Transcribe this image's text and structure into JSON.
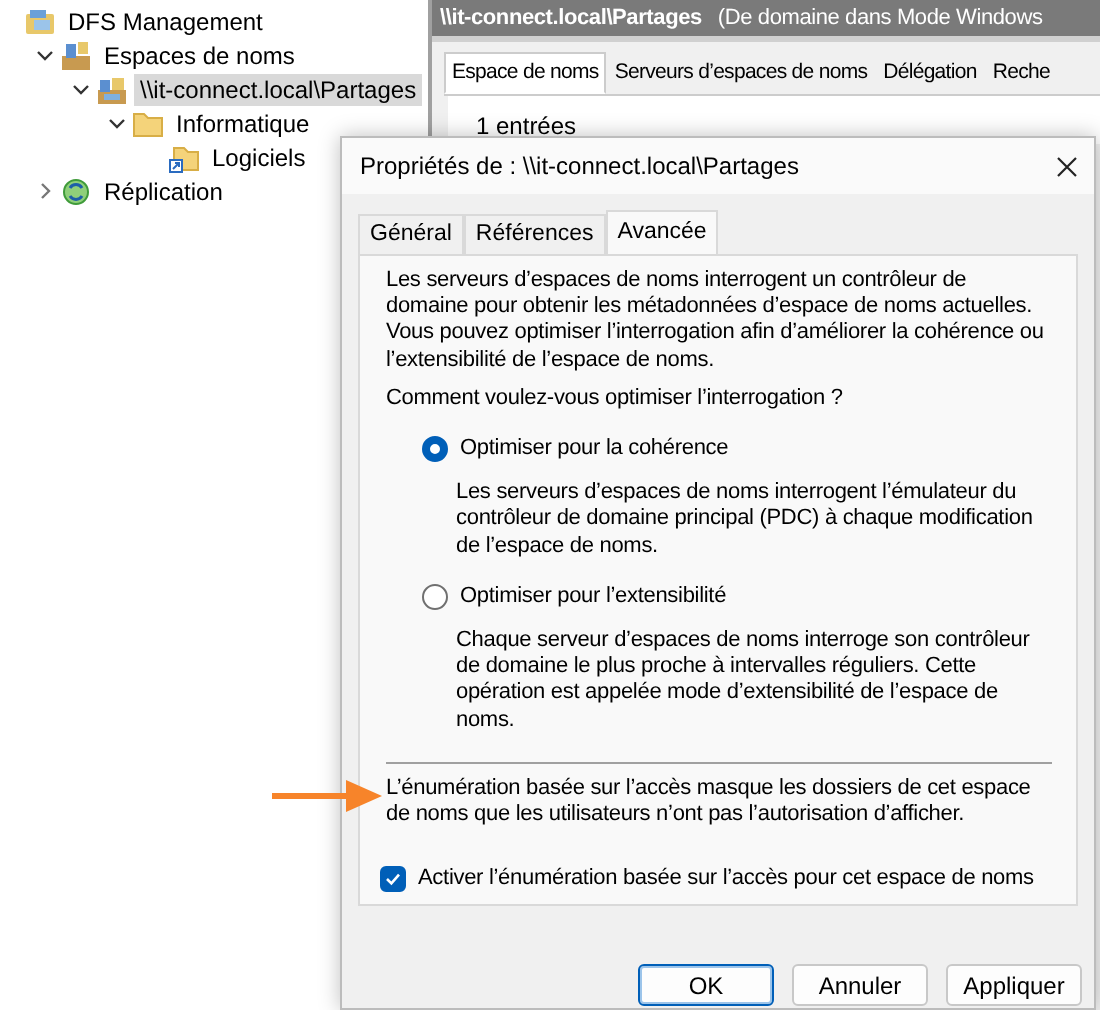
{
  "tree": [
    {
      "label": "DFS Management",
      "kind": "root",
      "selected": false,
      "children": [
        {
          "label": "Espaces de noms",
          "kind": "namespaces",
          "expanded": true,
          "selected": false,
          "children": [
            {
              "label": "\\\\it-connect.local\\Partages",
              "kind": "namespace",
              "expanded": true,
              "selected": true,
              "children": [
                {
                  "label": "Informatique",
                  "kind": "folder",
                  "expanded": true,
                  "selected": false,
                  "children": [
                    {
                      "label": "Logiciels",
                      "kind": "folder-link",
                      "selected": false
                    }
                  ]
                }
              ]
            }
          ]
        },
        {
          "label": "Réplication",
          "kind": "replication",
          "expanded": false,
          "selected": false
        }
      ]
    }
  ],
  "content_header": {
    "title": "\\\\it-connect.local\\Partages",
    "subtitle": "(De domaine dans Mode Windows"
  },
  "content_tabs": [
    {
      "label": "Espace de noms",
      "selected": true
    },
    {
      "label": "Serveurs d’espaces de noms",
      "selected": false
    },
    {
      "label": "Délégation",
      "selected": false
    },
    {
      "label": "Reche",
      "selected": false
    }
  ],
  "entry_count": "1 entrées",
  "dialog": {
    "title": "Propriétés de : \\\\it-connect.local\\Partages",
    "tabs": [
      {
        "label": "Général",
        "selected": false
      },
      {
        "label": "Références",
        "selected": false
      },
      {
        "label": "Avancée",
        "selected": true
      }
    ],
    "intro": "Les serveurs d’espaces de noms interrogent un contrôleur de domaine pour obtenir les métadonnées d’espace de noms actuelles. Vous pouvez optimiser l’interrogation afin d’améliorer la cohérence ou l’extensibilité de l’espace de noms.",
    "question": "Comment voulez-vous optimiser l’interrogation ?",
    "options": [
      {
        "label": "Optimiser pour la cohérence",
        "selected": true,
        "description": "Les serveurs d’espaces de noms interrogent l’émulateur du contrôleur de domaine principal (PDC) à chaque modification de l’espace de noms."
      },
      {
        "label": "Optimiser pour l’extensibilité",
        "selected": false,
        "description": "Chaque serveur d’espaces de noms interroge son contrôleur de domaine le plus proche à intervalles réguliers. Cette opération est appelée mode d’extensibilité de l’espace de noms."
      }
    ],
    "abe_description": "L’énumération basée sur l’accès masque les dossiers de cet espace de noms que les utilisateurs n’ont pas l’autorisation d’afficher.",
    "abe_checkbox": {
      "label": "Activer l’énumération basée sur l’accès pour cet espace de noms",
      "checked": true
    },
    "buttons": [
      {
        "label": "OK",
        "default": true
      },
      {
        "label": "Annuler",
        "default": false
      },
      {
        "label": "Appliquer",
        "default": false
      }
    ]
  }
}
